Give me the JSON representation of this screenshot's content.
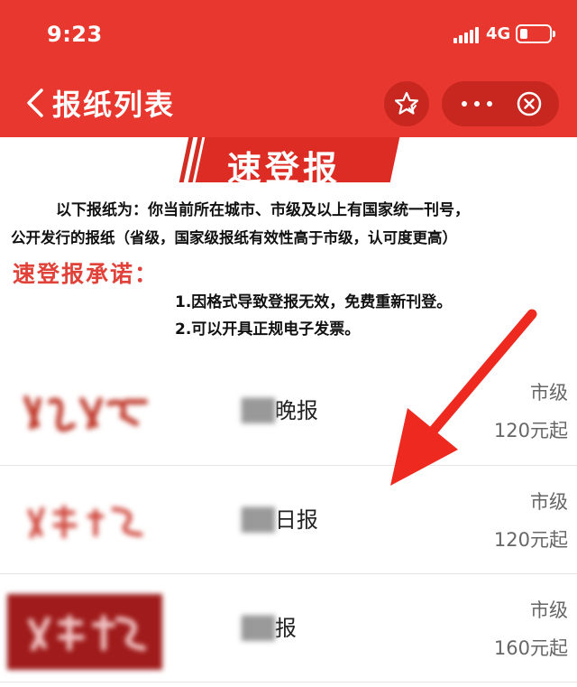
{
  "status_bar": {
    "time": "9:23",
    "network": "4G"
  },
  "nav": {
    "title": "报纸列表",
    "back_icon": "chevron-left-icon",
    "star_icon": "star-icon",
    "more_icon": "more-icon",
    "close_icon": "close-circle-icon"
  },
  "banner": {
    "title": "速登报"
  },
  "intro": {
    "line1": "以下报纸为：你当前所在城市、市级及以上有国家统一刊号，",
    "line2": "公开发行的报纸（省级，国家级报纸有效性高于市级，认可度更高）"
  },
  "promise": {
    "title": "速登报承诺：",
    "items": [
      "1.因格式导致登报无效，免费重新刊登。",
      "2.可以开具正规电子发票。"
    ]
  },
  "newspapers": [
    {
      "name_visible": "晚报",
      "level": "市级",
      "price": "120元起"
    },
    {
      "name_visible": "日报",
      "level": "市级",
      "price": "120元起"
    },
    {
      "name_visible": "报",
      "level": "市级",
      "price": "160元起"
    }
  ],
  "colors": {
    "brand_red": "#e8372e",
    "capsule_red": "#c8271f",
    "accent_red": "#e0423a"
  }
}
